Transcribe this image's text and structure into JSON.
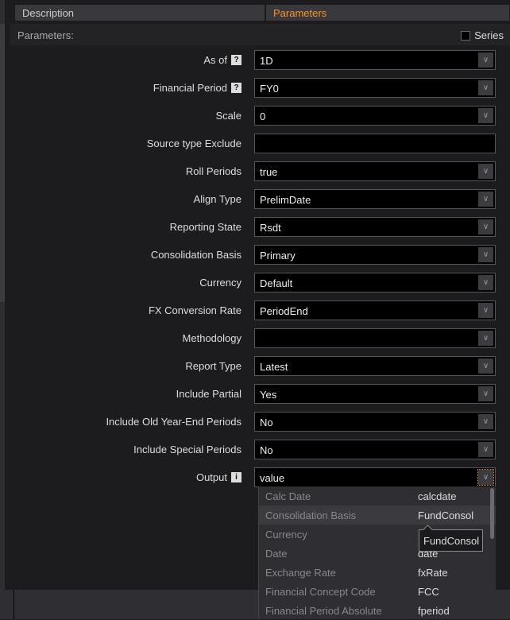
{
  "tabs": [
    {
      "label": "Description",
      "active": false
    },
    {
      "label": "Parameters",
      "active": true
    }
  ],
  "header": {
    "title": "Parameters:",
    "series_label": "Series",
    "series_checked": false
  },
  "accent": "#f5932a",
  "params": [
    {
      "label": "As of",
      "icon": "?",
      "value": "1D",
      "dropdown": true
    },
    {
      "label": "Financial Period",
      "icon": "?",
      "value": "FY0",
      "dropdown": true
    },
    {
      "label": "Scale",
      "value": "0",
      "dropdown": true
    },
    {
      "label": "Source type Exclude",
      "value": "",
      "dropdown": false
    },
    {
      "label": "Roll Periods",
      "value": "true",
      "dropdown": true
    },
    {
      "label": "Align Type",
      "value": "PrelimDate",
      "dropdown": true
    },
    {
      "label": "Reporting State",
      "value": "Rsdt",
      "dropdown": true
    },
    {
      "label": "Consolidation Basis",
      "value": "Primary",
      "dropdown": true
    },
    {
      "label": "Currency",
      "value": "Default",
      "dropdown": true
    },
    {
      "label": "FX Conversion Rate",
      "value": "PeriodEnd",
      "dropdown": true
    },
    {
      "label": "Methodology",
      "value": "",
      "dropdown": true
    },
    {
      "label": "Report Type",
      "value": "Latest",
      "dropdown": true
    },
    {
      "label": "Include Partial",
      "value": "Yes",
      "dropdown": true
    },
    {
      "label": "Include Old Year-End Periods",
      "value": "No",
      "dropdown": true
    },
    {
      "label": "Include Special Periods",
      "value": "No",
      "dropdown": true
    },
    {
      "label": "Output",
      "icon": "i",
      "value": "value",
      "dropdown": true,
      "open": true
    }
  ],
  "output_options": [
    {
      "label": "Calc Date",
      "code": "calcdate"
    },
    {
      "label": "Consolidation Basis",
      "code": "FundConsol",
      "highlighted": true
    },
    {
      "label": "Currency",
      "code": ""
    },
    {
      "label": "Date",
      "code": "date"
    },
    {
      "label": "Exchange Rate",
      "code": "fxRate"
    },
    {
      "label": "Financial Concept Code",
      "code": "FCC"
    },
    {
      "label": "Financial Period Absolute",
      "code": "fperiod"
    }
  ],
  "tooltip": "FundConsol"
}
